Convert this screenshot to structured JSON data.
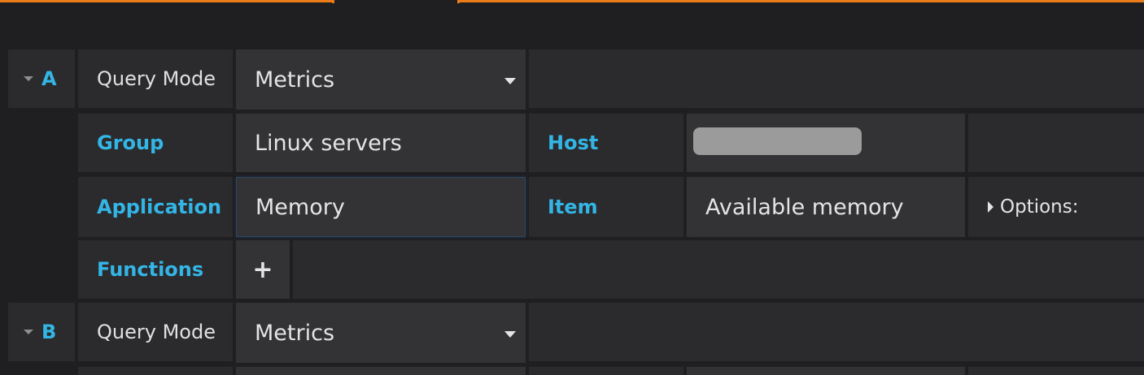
{
  "colors": {
    "accent": "#33b5e5",
    "tab_border": "#eb7b18",
    "background": "#1f1e20"
  },
  "queries": [
    {
      "ref": "A",
      "query_mode_label": "Query Mode",
      "query_mode_value": "Metrics",
      "group_label": "Group",
      "group_value": "Linux servers",
      "host_label": "Host",
      "application_label": "Application",
      "application_value": "Memory",
      "item_label": "Item",
      "item_value": "Available memory",
      "options_label": "Options:",
      "functions_label": "Functions",
      "add_function_icon": "+"
    },
    {
      "ref": "B",
      "query_mode_label": "Query Mode",
      "query_mode_value": "Metrics"
    }
  ]
}
